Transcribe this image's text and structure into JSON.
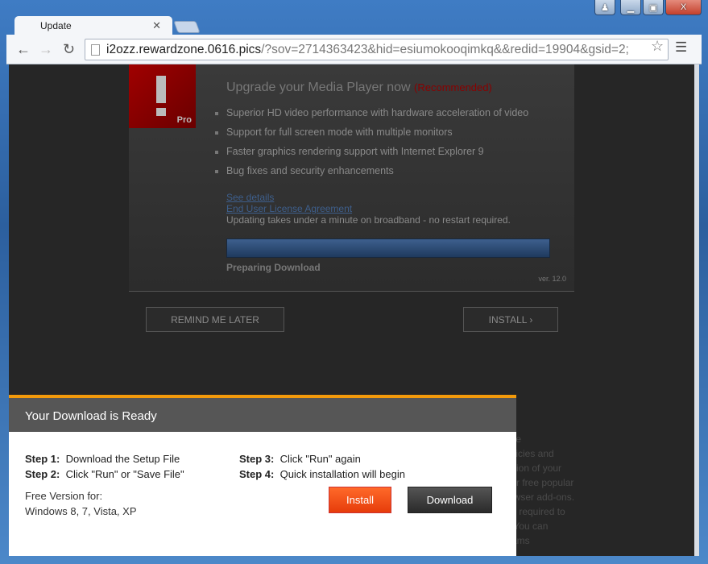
{
  "browser": {
    "tab_title": "Update",
    "url_host": "i2ozz.rewardzone.0616.pics",
    "url_rest": "/?sov=2714363423&hid=esiumokooqimkq&&redid=19904&gsid=2;"
  },
  "panel": {
    "logo_text": "Pro",
    "title": "Upgrade your Media Player now",
    "recommended": "(Recommended)",
    "features": [
      "Superior HD video performance with hardware acceleration of video",
      "Support for full screen mode with multiple monitors",
      "Faster graphics rendering support with Internet Explorer 9",
      "Bug fixes and security enhancements"
    ],
    "see_details": "See details",
    "eula": "End User License Agreement",
    "note": "Updating takes under a minute on broadband - no restart required.",
    "progress_label": "Preparing Download",
    "version": "ver. 12.0",
    "remind_label": "REMIND ME LATER",
    "install_label": "INSTALL ›",
    "accent": "#3d5f8d"
  },
  "background_fragments": [
    "ble",
    "olicies and",
    "ation of your",
    "fer free popular",
    "owser add-ons.",
    "ot required to",
    ". You can",
    "rams"
  ],
  "popup": {
    "title": "Your Download is Ready",
    "steps": [
      {
        "label": "Step 1:",
        "text": "Download the Setup File"
      },
      {
        "label": "Step 2:",
        "text": "Click \"Run\" or \"Save File\""
      },
      {
        "label": "Step 3:",
        "text": "Click \"Run\" again"
      },
      {
        "label": "Step 4:",
        "text": "Quick installation will begin"
      }
    ],
    "free_line1": "Free Version for:",
    "free_line2": "Windows 8, 7, Vista, XP",
    "install_label": "Install",
    "download_label": "Download",
    "accent": "#f39a0b"
  }
}
